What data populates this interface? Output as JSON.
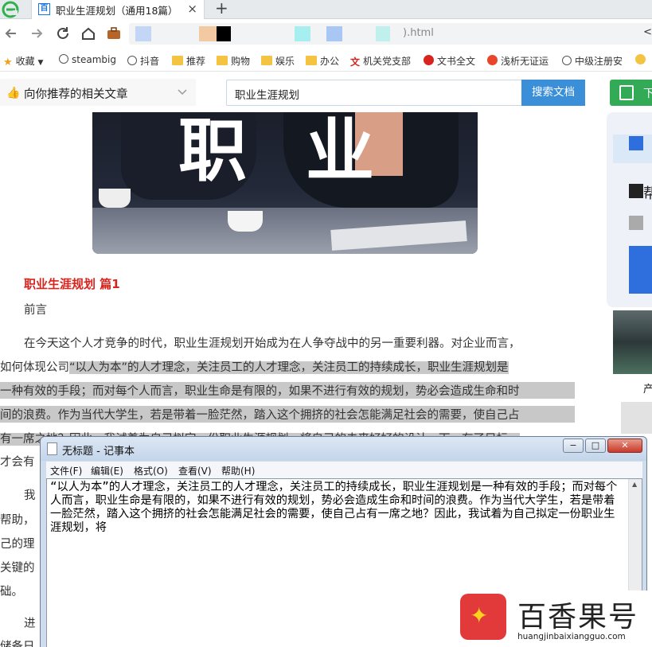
{
  "browser": {
    "tab_title": "职业生涯规划（通用18篇）",
    "tab_favicon": "百",
    "close_tab": "×",
    "new_tab": "+",
    "url_suffix": ").html",
    "url_right": "<"
  },
  "nav_icons": [
    "back-icon",
    "forward-icon",
    "reload-icon",
    "home-icon",
    "briefcase-icon"
  ],
  "bookmarks": [
    {
      "label": "收藏",
      "icon": "star-icon"
    },
    {
      "label": "steambig",
      "icon": "globe-icon"
    },
    {
      "label": "抖音",
      "icon": "globe-icon"
    },
    {
      "label": "推荐",
      "icon": "folder-icon"
    },
    {
      "label": "购物",
      "icon": "folder-icon"
    },
    {
      "label": "娱乐",
      "icon": "folder-icon"
    },
    {
      "label": "办公",
      "icon": "folder-icon"
    },
    {
      "label": "机关党支部",
      "icon": "wen-icon"
    },
    {
      "label": "文书全文",
      "icon": "emblem-icon"
    },
    {
      "label": "浅析无证运",
      "icon": "flame-icon"
    },
    {
      "label": "中级注册安",
      "icon": "globe-icon"
    }
  ],
  "toolbar": {
    "recommend_label": "向你推荐的相关文章",
    "search_value": "职业生涯规划",
    "search_button": "搜索文档",
    "green_button": "下"
  },
  "hero": {
    "chars": [
      "职",
      "业"
    ]
  },
  "article": {
    "heading": "职业生涯规划 篇1",
    "preface": "前言",
    "lines": [
      "在今天这个人才竞争的时代，职业生涯规划开始成为在人争夺战中的另一重要利器。对企业而言，",
      "如何体现公司",
      "“以人为本”的人才理念，关注员工的人才理念，关注员工的持续成长，职业生涯规划是",
      "一种有效的手段；而对每个人而言，职业生命是有限的，如果不进行有效的规划，势必会造成生命和时",
      "间的浪费。作为当代大学生，若是带着一脸茫然，踏入这个拥挤的社会怎能满足社会的需要，使自己占",
      "有一席之地？因此，我试着为自己拟定一份职业生涯规划，将自己的未来好好的设计一下，有了目标，",
      "才会有"
    ],
    "fragments": [
      "我",
      "帮助，",
      "己的理",
      "关键的",
      "础。",
      "进",
      "储备日"
    ]
  },
  "sidebar": {
    "partial_text": [
      "帮",
      "产"
    ]
  },
  "notepad": {
    "title": "无标题 - 记事本",
    "menu": [
      "文件(F)",
      "编辑(E)",
      "格式(O)",
      "查看(V)",
      "帮助(H)"
    ],
    "content": "“以人为本”的人才理念，关注员工的人才理念，关注员工的持续成长，职业生涯规划是一种有效的手段；而对每个人而言，职业生命是有限的，如果不进行有效的规划，势必会造成生命和时间的浪费。作为当代大学生，若是带着一脸茫然，踏入这个拥挤的社会怎能满足社会的需要，使自己占有一席之地？因此，我试着为自己拟定一份职业生涯规划，将",
    "buttons": [
      "−",
      "□",
      "✕"
    ]
  },
  "watermark": {
    "name": "百香果号",
    "domain": "huangjinbaixiangguo.com"
  },
  "colors": {
    "accent_red": "#d9231d",
    "search_blue": "#3b8fd8",
    "green": "#33aa55",
    "highlight": "#c8c8c8"
  }
}
